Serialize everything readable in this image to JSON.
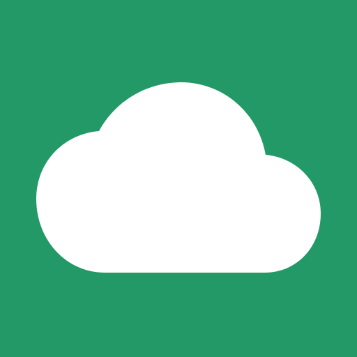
{
  "icon": {
    "name": "cloud-icon",
    "background_color": "#229966",
    "foreground_color": "#FFFFFF"
  }
}
